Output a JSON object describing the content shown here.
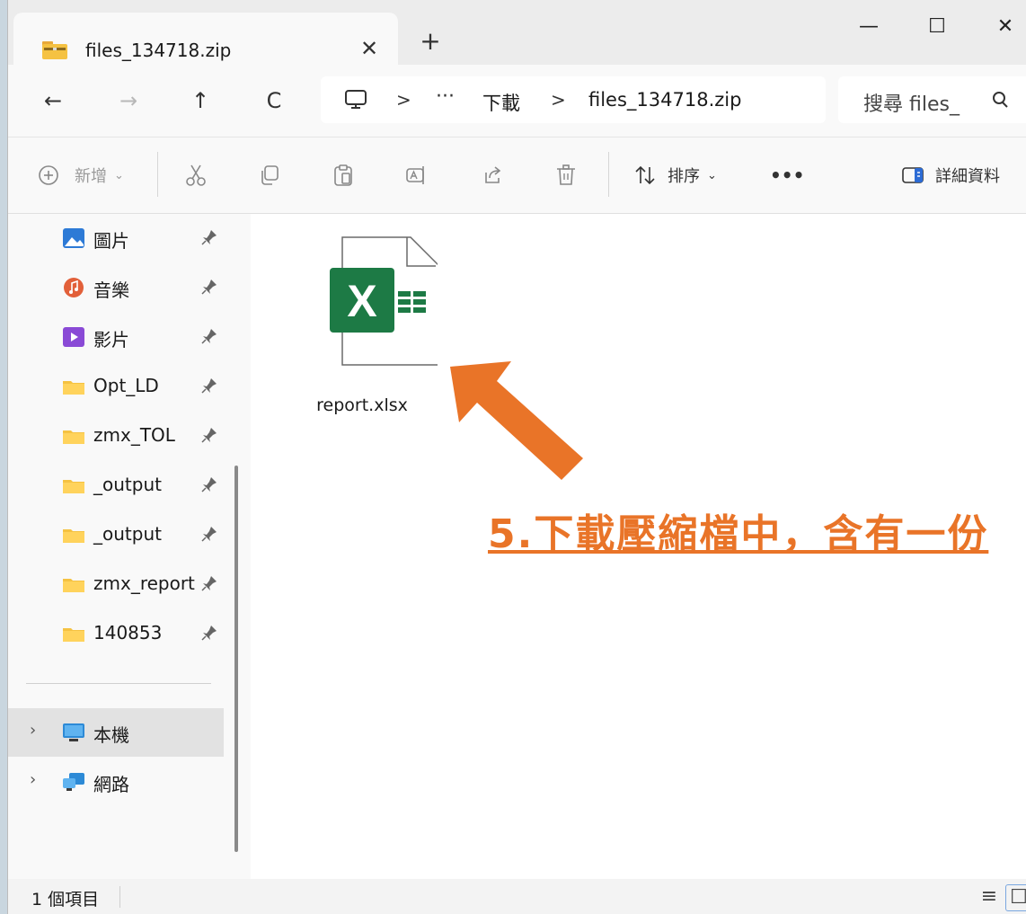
{
  "tab": {
    "title": "files_134718.zip",
    "close": "✕",
    "new_tab": "+"
  },
  "window_controls": {
    "minimize": "—",
    "maximize": "☐",
    "close": "✕"
  },
  "nav": {
    "back": "←",
    "forward": "→",
    "up": "↑",
    "refresh": "C"
  },
  "address": {
    "sep1": ">",
    "overflow": "···",
    "crumb1": "下載",
    "sep2": ">",
    "crumb2": "files_134718.zip"
  },
  "search": {
    "text": "搜尋 files_"
  },
  "commands": {
    "new_label": "新增",
    "sort_label": "排序",
    "more": "•••",
    "details_label": "詳細資料"
  },
  "sidebar": {
    "items": [
      {
        "label": "圖片",
        "icon": "pictures-icon"
      },
      {
        "label": "音樂",
        "icon": "music-icon"
      },
      {
        "label": "影片",
        "icon": "videos-icon"
      },
      {
        "label": "Opt_LD",
        "icon": "folder-icon"
      },
      {
        "label": "zmx_TOL",
        "icon": "folder-icon"
      },
      {
        "label": "_output",
        "icon": "folder-icon"
      },
      {
        "label": "_output",
        "icon": "folder-icon"
      },
      {
        "label": "zmx_report",
        "icon": "folder-icon"
      },
      {
        "label": "140853",
        "icon": "folder-icon"
      }
    ],
    "this_pc": "本機",
    "network": "網路"
  },
  "files": [
    {
      "name": "report.xlsx",
      "icon": "excel-file-icon"
    }
  ],
  "annotation": {
    "text": "5.下載壓縮檔中，含有一份",
    "color": "#e97428"
  },
  "status": {
    "count": "1 個項目",
    "list_view": "≡",
    "tile_view": "☐"
  },
  "colors": {
    "accent": "#e97428",
    "excel_green": "#1d7a45",
    "folder": "#f5c242"
  }
}
